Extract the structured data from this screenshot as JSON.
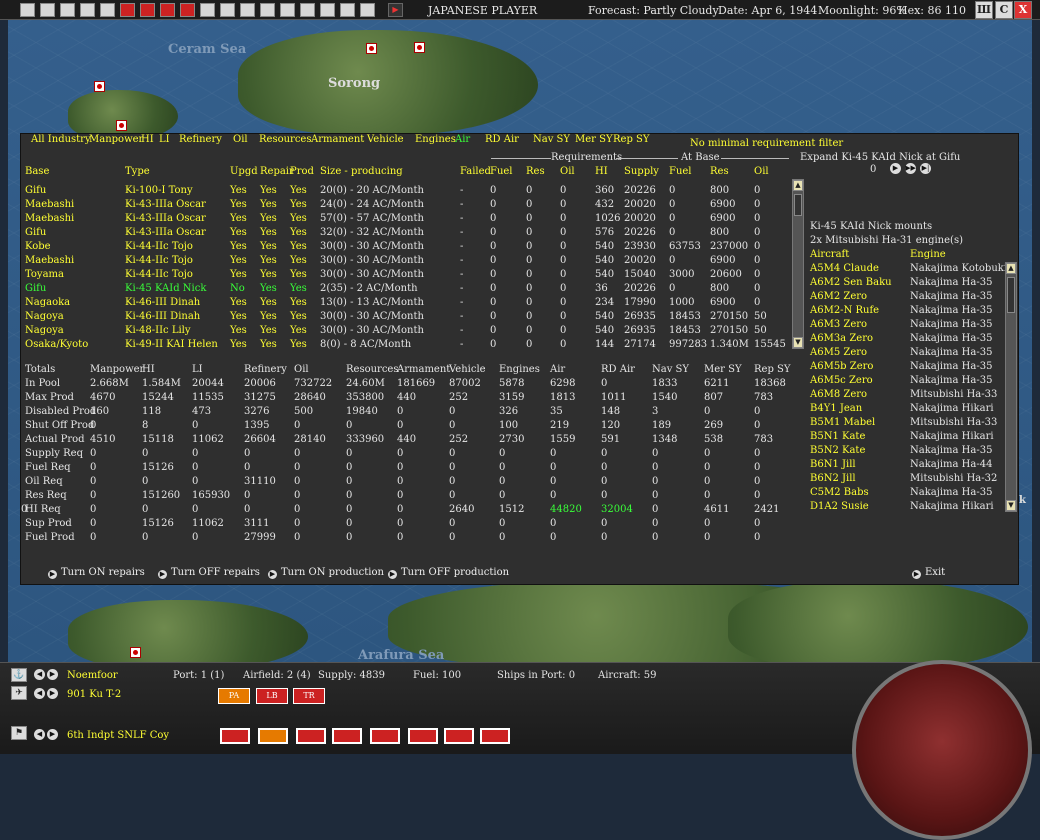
{
  "toolbar": {
    "icons": [
      "menu-icon",
      "end-turn-icon",
      "reports-icon",
      "intel-icon",
      "info-icon",
      "sun-flag-icon",
      "cross-icon",
      "plane-icon",
      "flag-icon",
      "aircraft-icon",
      "stack-icon",
      "list-icon",
      "map-icon",
      "globe-icon",
      "link-icon",
      "op-icon",
      "grid-icon",
      "window-icon",
      "play-icon"
    ],
    "title": "JAPANESE PLAYER",
    "forecast": "Forecast: Partly Cloudy",
    "date": "Date:  Apr 6, 1944",
    "moonlight": "Moonlight: 96%",
    "hex": "Hex: 86 110",
    "win_buttons": [
      "Ш",
      "C",
      "X"
    ]
  },
  "map": {
    "labels": [
      "Ceram Sea",
      "Sorong",
      "Arafura Sea"
    ]
  },
  "filters": {
    "items": [
      "All Industry",
      "Manpower",
      "HI",
      "LI",
      "Refinery",
      "Oil",
      "Resources",
      "Armament",
      "Vehicle",
      "Engines",
      "Air",
      "RD Air",
      "Nav SY",
      "Mer SY",
      "Rep SY"
    ],
    "active": "Air",
    "no_min": "No minimal requirement filter"
  },
  "headers": {
    "requirements": "Requirements",
    "at_base": "At Base",
    "cols": [
      "Base",
      "Type",
      "Upgd",
      "Repair",
      "Prod",
      "Size - producing",
      "Failed",
      "Fuel",
      "Res",
      "Oil",
      "HI",
      "Supply",
      "Fuel",
      "Res",
      "Oil"
    ]
  },
  "factories": [
    [
      "Gifu",
      "Ki-100-I Tony",
      "Yes",
      "Yes",
      "Yes",
      "20(0) - 20 AC/Month",
      "-",
      "0",
      "0",
      "0",
      "360",
      "20226",
      "0",
      "800",
      "0"
    ],
    [
      "Maebashi",
      "Ki-43-IIIa Oscar",
      "Yes",
      "Yes",
      "Yes",
      "24(0) - 24 AC/Month",
      "-",
      "0",
      "0",
      "0",
      "432",
      "20020",
      "0",
      "6900",
      "0"
    ],
    [
      "Maebashi",
      "Ki-43-IIIa Oscar",
      "Yes",
      "Yes",
      "Yes",
      "57(0) - 57 AC/Month",
      "-",
      "0",
      "0",
      "0",
      "1026",
      "20020",
      "0",
      "6900",
      "0"
    ],
    [
      "Gifu",
      "Ki-43-IIIa Oscar",
      "Yes",
      "Yes",
      "Yes",
      "32(0) - 32 AC/Month",
      "-",
      "0",
      "0",
      "0",
      "576",
      "20226",
      "0",
      "800",
      "0"
    ],
    [
      "Kobe",
      "Ki-44-IIc Tojo",
      "Yes",
      "Yes",
      "Yes",
      "30(0) - 30 AC/Month",
      "-",
      "0",
      "0",
      "0",
      "540",
      "23930",
      "63753",
      "237000",
      "0"
    ],
    [
      "Maebashi",
      "Ki-44-IIc Tojo",
      "Yes",
      "Yes",
      "Yes",
      "30(0) - 30 AC/Month",
      "-",
      "0",
      "0",
      "0",
      "540",
      "20020",
      "0",
      "6900",
      "0"
    ],
    [
      "Toyama",
      "Ki-44-IIc Tojo",
      "Yes",
      "Yes",
      "Yes",
      "30(0) - 30 AC/Month",
      "-",
      "0",
      "0",
      "0",
      "540",
      "15040",
      "3000",
      "20600",
      "0"
    ],
    [
      "Gifu",
      "Ki-45 KAId Nick",
      "No",
      "Yes",
      "Yes",
      "2(35) - 2 AC/Month",
      "-",
      "0",
      "0",
      "0",
      "36",
      "20226",
      "0",
      "800",
      "0"
    ],
    [
      "Nagaoka",
      "Ki-46-III Dinah",
      "Yes",
      "Yes",
      "Yes",
      "13(0) - 13 AC/Month",
      "-",
      "0",
      "0",
      "0",
      "234",
      "17990",
      "1000",
      "6900",
      "0"
    ],
    [
      "Nagoya",
      "Ki-46-III Dinah",
      "Yes",
      "Yes",
      "Yes",
      "30(0) - 30 AC/Month",
      "-",
      "0",
      "0",
      "0",
      "540",
      "26935",
      "18453",
      "270150",
      "50"
    ],
    [
      "Nagoya",
      "Ki-48-IIc Lily",
      "Yes",
      "Yes",
      "Yes",
      "30(0) - 30 AC/Month",
      "-",
      "0",
      "0",
      "0",
      "540",
      "26935",
      "18453",
      "270150",
      "50"
    ],
    [
      "Osaka/Kyoto",
      "Ki-49-II KAI Helen",
      "Yes",
      "Yes",
      "Yes",
      "8(0) - 8 AC/Month",
      "-",
      "0",
      "0",
      "0",
      "144",
      "27174",
      "997283",
      "1.340M",
      "15545"
    ]
  ],
  "selected_row": 7,
  "totals": {
    "cols": [
      "Totals",
      "Manpower",
      "HI",
      "LI",
      "Refinery",
      "Oil",
      "Resources",
      "Armament",
      "Vehicle",
      "Engines",
      "Air",
      "RD Air",
      "Nav SY",
      "Mer SY",
      "Rep SY"
    ],
    "rows": [
      [
        "In Pool",
        "2.668M",
        "1.584M",
        "20044",
        "20006",
        "732722",
        "24.60M",
        "181669",
        "87002",
        "5878",
        "6298",
        "0",
        "1833",
        "6211",
        "18368"
      ],
      [
        "Max Prod",
        "4670",
        "15244",
        "11535",
        "31275",
        "28640",
        "353800",
        "440",
        "252",
        "3159",
        "1813",
        "1011",
        "1540",
        "807",
        "783"
      ],
      [
        "Disabled Prod",
        "160",
        "118",
        "473",
        "3276",
        "500",
        "19840",
        "0",
        "0",
        "326",
        "35",
        "148",
        "3",
        "0",
        "0"
      ],
      [
        "Shut Off Prod",
        "0",
        "8",
        "0",
        "1395",
        "0",
        "0",
        "0",
        "0",
        "100",
        "219",
        "120",
        "189",
        "269",
        "0"
      ],
      [
        "Actual Prod",
        "4510",
        "15118",
        "11062",
        "26604",
        "28140",
        "333960",
        "440",
        "252",
        "2730",
        "1559",
        "591",
        "1348",
        "538",
        "783"
      ],
      [
        "Supply Req",
        "0",
        "0",
        "0",
        "0",
        "0",
        "0",
        "0",
        "0",
        "0",
        "0",
        "0",
        "0",
        "0",
        "0"
      ],
      [
        "Fuel Req",
        "0",
        "15126",
        "0",
        "0",
        "0",
        "0",
        "0",
        "0",
        "0",
        "0",
        "0",
        "0",
        "0",
        "0"
      ],
      [
        "Oil Req",
        "0",
        "0",
        "0",
        "31110",
        "0",
        "0",
        "0",
        "0",
        "0",
        "0",
        "0",
        "0",
        "0",
        "0"
      ],
      [
        "Res Req",
        "0",
        "151260",
        "165930",
        "0",
        "0",
        "0",
        "0",
        "0",
        "0",
        "0",
        "0",
        "0",
        "0",
        "0"
      ],
      [
        "HI Req",
        "0",
        "0",
        "0",
        "0",
        "0",
        "0",
        "0",
        "0",
        "2640",
        "1512",
        "44820",
        "32004",
        "0",
        "4611",
        "2421",
        "0"
      ],
      [
        "Sup Prod",
        "0",
        "15126",
        "11062",
        "3111",
        "0",
        "0",
        "0",
        "0",
        "0",
        "0",
        "0",
        "0",
        "0",
        "0"
      ],
      [
        "Fuel Prod",
        "0",
        "0",
        "0",
        "27999",
        "0",
        "0",
        "0",
        "0",
        "0",
        "0",
        "0",
        "0",
        "0",
        "0"
      ]
    ]
  },
  "hi_req": [
    "HI Req",
    "0",
    "0",
    "0",
    "0",
    "0",
    "0",
    "0",
    "2640",
    "1512",
    "44820",
    "32004",
    "0",
    "4611",
    "2421",
    "0"
  ],
  "right": {
    "expand": "Expand Ki-45 KAId Nick at Gifu",
    "counter": "0",
    "mounts": "Ki-45 KAId Nick mounts",
    "engine_line": "2x Mitsubishi Ha-31  engine(s)",
    "col_aircraft": "Aircraft",
    "col_engine": "Engine",
    "list": [
      [
        "A5M4 Claude",
        "Nakajima Kotobuki"
      ],
      [
        "A6M2 Sen Baku",
        "Nakajima Ha-35"
      ],
      [
        "A6M2 Zero",
        "Nakajima Ha-35"
      ],
      [
        "A6M2-N Rufe",
        "Nakajima Ha-35"
      ],
      [
        "A6M3 Zero",
        "Nakajima Ha-35"
      ],
      [
        "A6M3a Zero",
        "Nakajima Ha-35"
      ],
      [
        "A6M5 Zero",
        "Nakajima Ha-35"
      ],
      [
        "A6M5b Zero",
        "Nakajima Ha-35"
      ],
      [
        "A6M5c Zero",
        "Nakajima Ha-35"
      ],
      [
        "A6M8 Zero",
        "Mitsubishi Ha-33"
      ],
      [
        "B4Y1 Jean",
        "Nakajima Hikari"
      ],
      [
        "B5M1 Mabel",
        "Mitsubishi Ha-33"
      ],
      [
        "B5N1 Kate",
        "Nakajima Hikari"
      ],
      [
        "B5N2 Kate",
        "Nakajima Ha-35"
      ],
      [
        "B6N1 Jill",
        "Nakajima Ha-44"
      ],
      [
        "B6N2 Jill",
        "Mitsubishi Ha-32"
      ],
      [
        "C5M2 Babs",
        "Nakajima Ha-35"
      ],
      [
        "D1A2 Susie",
        "Nakajima Hikari"
      ]
    ]
  },
  "commands": {
    "on_repairs": "Turn ON repairs",
    "off_repairs": "Turn OFF repairs",
    "on_prod": "Turn ON production",
    "off_prod": "Turn OFF production",
    "exit": "Exit"
  },
  "bottom": {
    "base": "Noemfoor",
    "port": "Port: 1 (1)",
    "airfield": "Airfield: 2 (4)",
    "supply": "Supply: 4839",
    "fuel": "Fuel: 100",
    "ships": "Ships in Port: 0",
    "aircraft": "Aircraft: 59",
    "unit2": "901 Ku T-2",
    "unit3": "6th Indpt SNLF Coy",
    "ac_buttons": [
      "PA",
      "LB",
      "TR"
    ],
    "corner_letter": "k"
  }
}
